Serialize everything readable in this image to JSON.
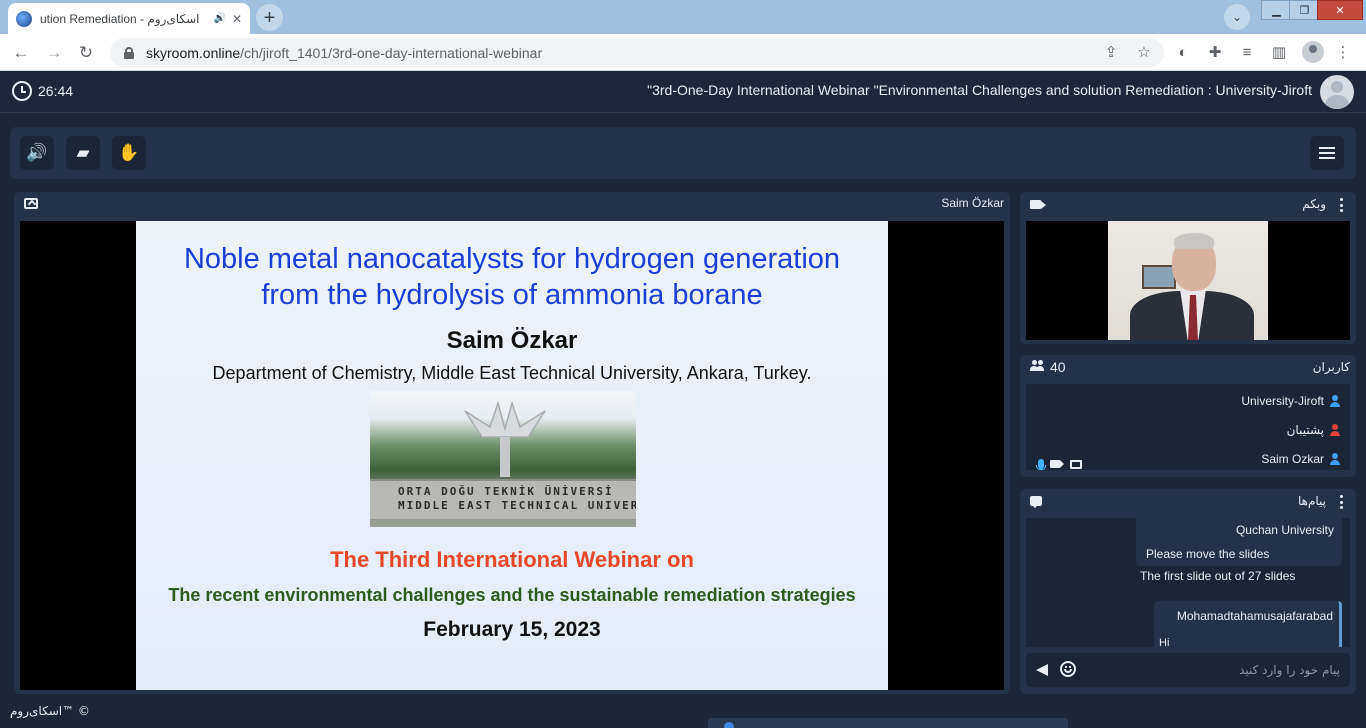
{
  "browser": {
    "tab_title": "ution Remediation - اسکای‌روم",
    "tab_audio": "🔊",
    "tab_close": "✕",
    "new_tab": "+",
    "url_host": "skyroom.online",
    "url_path": "/ch/jiroft_1401/3rd-one-day-international-webinar",
    "nav": {
      "back": "←",
      "forward": "→",
      "reload": "↻"
    }
  },
  "app": {
    "timer": "26:44",
    "room_title": "\"3rd-One-Day International Webinar \"Environmental Challenges and solution Remediation : University-Jiroft",
    "footer_brand": "اسکای‌روم™ ©"
  },
  "toolbar": {
    "speaker": "🔊",
    "board": "▰",
    "hand": "✋"
  },
  "presentation": {
    "presenter": "Saim Özkar",
    "slide": {
      "title_line1": "Noble metal nanocatalysts for hydrogen generation",
      "title_line2": "from the hydrolysis of ammonia borane",
      "author": "Saim Özkar",
      "department": "Department of Chemistry, Middle East Technical University, Ankara, Turkey.",
      "sign_line1": "ORTA DOĞU TEKNİK ÜNİVERSİ",
      "sign_line2": "MIDDLE EAST TECHNICAL UNIVER",
      "webinar": "The Third International Webinar on",
      "topic": "The recent environmental challenges and the sustainable remediation strategies",
      "date": "February 15, 2023"
    }
  },
  "webcam": {
    "title": "وبکم"
  },
  "users": {
    "title": "کاربران",
    "count": "40",
    "list": [
      {
        "name": "University-Jiroft",
        "color": "#3fa0ff"
      },
      {
        "name": "پشتیبان",
        "color": "#e5413b"
      },
      {
        "name": "Saim Ozkar",
        "color": "#3fa0ff"
      }
    ]
  },
  "chat": {
    "title": "پیام‌ها",
    "messages": [
      {
        "sender": "Quchan University",
        "text": "Please move the slides"
      },
      {
        "sender": "",
        "text": "The first slide out of 27 slides"
      },
      {
        "sender": "Mohamadtahamusajafarabad",
        "text": "Hi"
      }
    ],
    "input_placeholder": "پیام خود را وارد کنید"
  }
}
